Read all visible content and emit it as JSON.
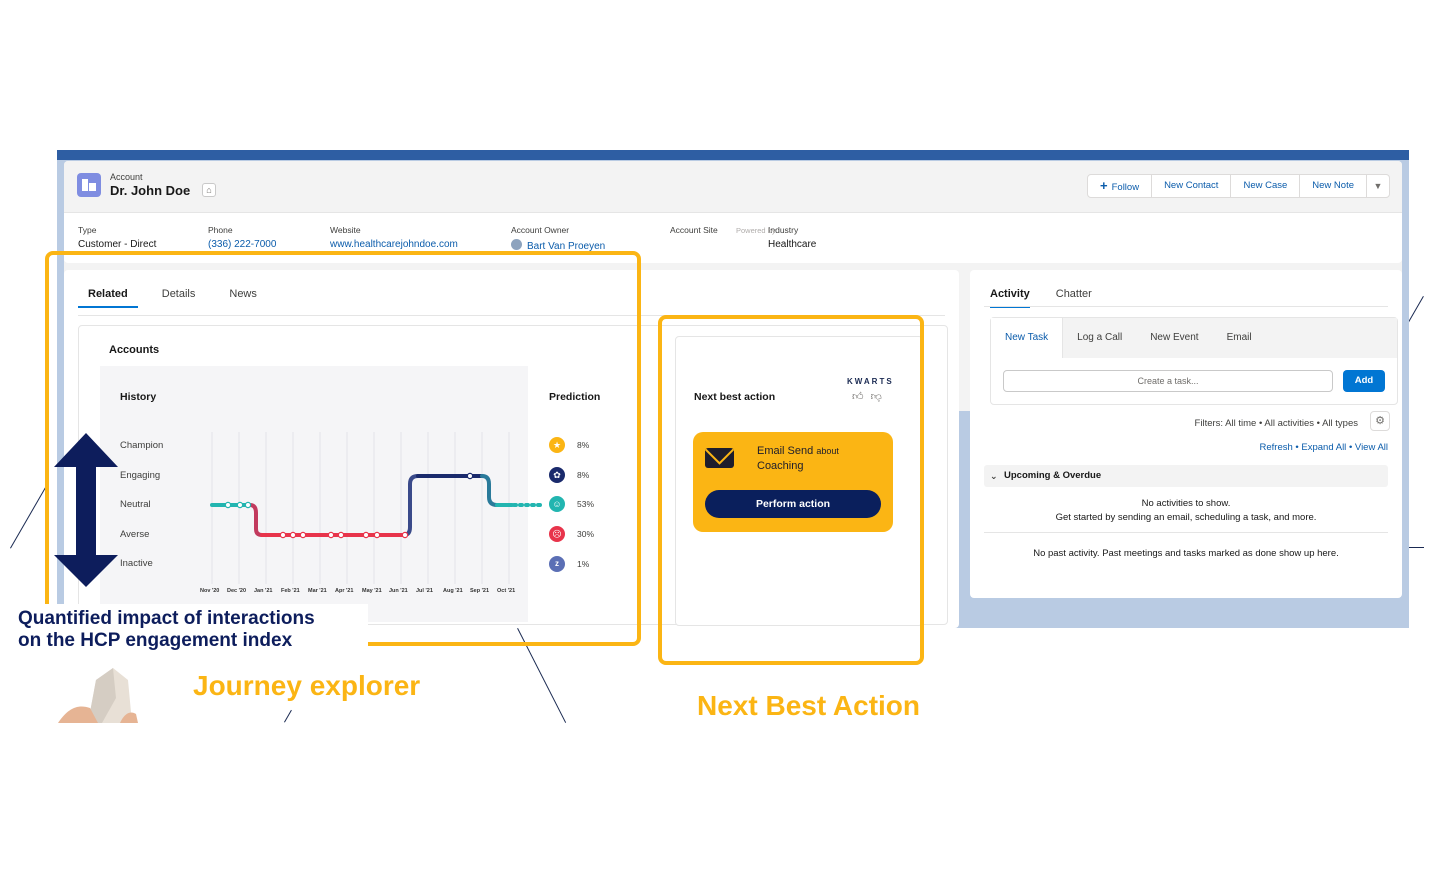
{
  "header": {
    "record_type": "Account",
    "account_name": "Dr. John Doe",
    "buttons": {
      "follow": "Follow",
      "new_contact": "New Contact",
      "new_case": "New Case",
      "new_note": "New Note"
    }
  },
  "fields": {
    "type": {
      "label": "Type",
      "value": "Customer - Direct"
    },
    "phone": {
      "label": "Phone",
      "value": "(336) 222-7000"
    },
    "website": {
      "label": "Website",
      "value": "www.healthcarejohndoe.com"
    },
    "owner": {
      "label": "Account Owner",
      "value": "Bart Van Proeyen"
    },
    "site": {
      "label": "Account Site",
      "value": ""
    },
    "industry": {
      "label": "Industry",
      "value": "Healthcare"
    }
  },
  "main_tabs": [
    "Related",
    "Details",
    "News"
  ],
  "accounts_card": {
    "title": "Accounts",
    "history_title": "History",
    "prediction_title": "Prediction",
    "levels": [
      "Champion",
      "Engaging",
      "Neutral",
      "Averse",
      "Inactive"
    ],
    "months": [
      "Nov '20",
      "Dec '20",
      "Jan '21",
      "Feb '21",
      "Mar '21",
      "Apr '21",
      "May '21",
      "Jun '21",
      "Jul '21",
      "Aug '21",
      "Sep '21",
      "Oct '21"
    ],
    "predictions": [
      {
        "level": "Champion",
        "pct": "8%",
        "color": "#fbb514",
        "icon": "star-icon"
      },
      {
        "level": "Engaging",
        "pct": "8%",
        "color": "#1a2a6c",
        "icon": "engaging-icon"
      },
      {
        "level": "Neutral",
        "pct": "53%",
        "color": "#22b5b0",
        "icon": "neutral-face-icon"
      },
      {
        "level": "Averse",
        "pct": "30%",
        "color": "#e8344b",
        "icon": "sad-face-icon"
      },
      {
        "level": "Inactive",
        "pct": "1%",
        "color": "#5b6fb5",
        "icon": "sleep-icon"
      }
    ]
  },
  "nba": {
    "powered_by": "Powered by",
    "brand": "KWARTS",
    "title": "Next best action",
    "action_main": "Email Send",
    "action_small": "about",
    "action_topic": "Coaching",
    "button": "Perform action"
  },
  "activity": {
    "tabs": [
      "Activity",
      "Chatter"
    ],
    "composer_tabs": [
      "New Task",
      "Log a Call",
      "New Event",
      "Email"
    ],
    "task_placeholder": "Create a task...",
    "add_button": "Add",
    "filters": "Filters: All time • All activities • All types",
    "links": [
      "Refresh",
      "Expand All",
      "View All"
    ],
    "upcoming": "Upcoming & Overdue",
    "no_activities": "No activities to show.",
    "get_started": "Get started by sending an email, scheduling a task, and more.",
    "no_past": "No past activity. Past meetings and tasks marked as done show up here."
  },
  "annotations": {
    "quantified_line1": "Quantified impact of interactions",
    "quantified_line2": "on the HCP engagement index",
    "journey": "Journey explorer",
    "next_best_action": "Next Best Action"
  },
  "colors": {
    "highlight": "#fbb514",
    "navy": "#0d1d5c",
    "averse_path": "#e8344b",
    "engaging_path": "#1a2a6c",
    "neutral_path": "#22b5b0"
  }
}
